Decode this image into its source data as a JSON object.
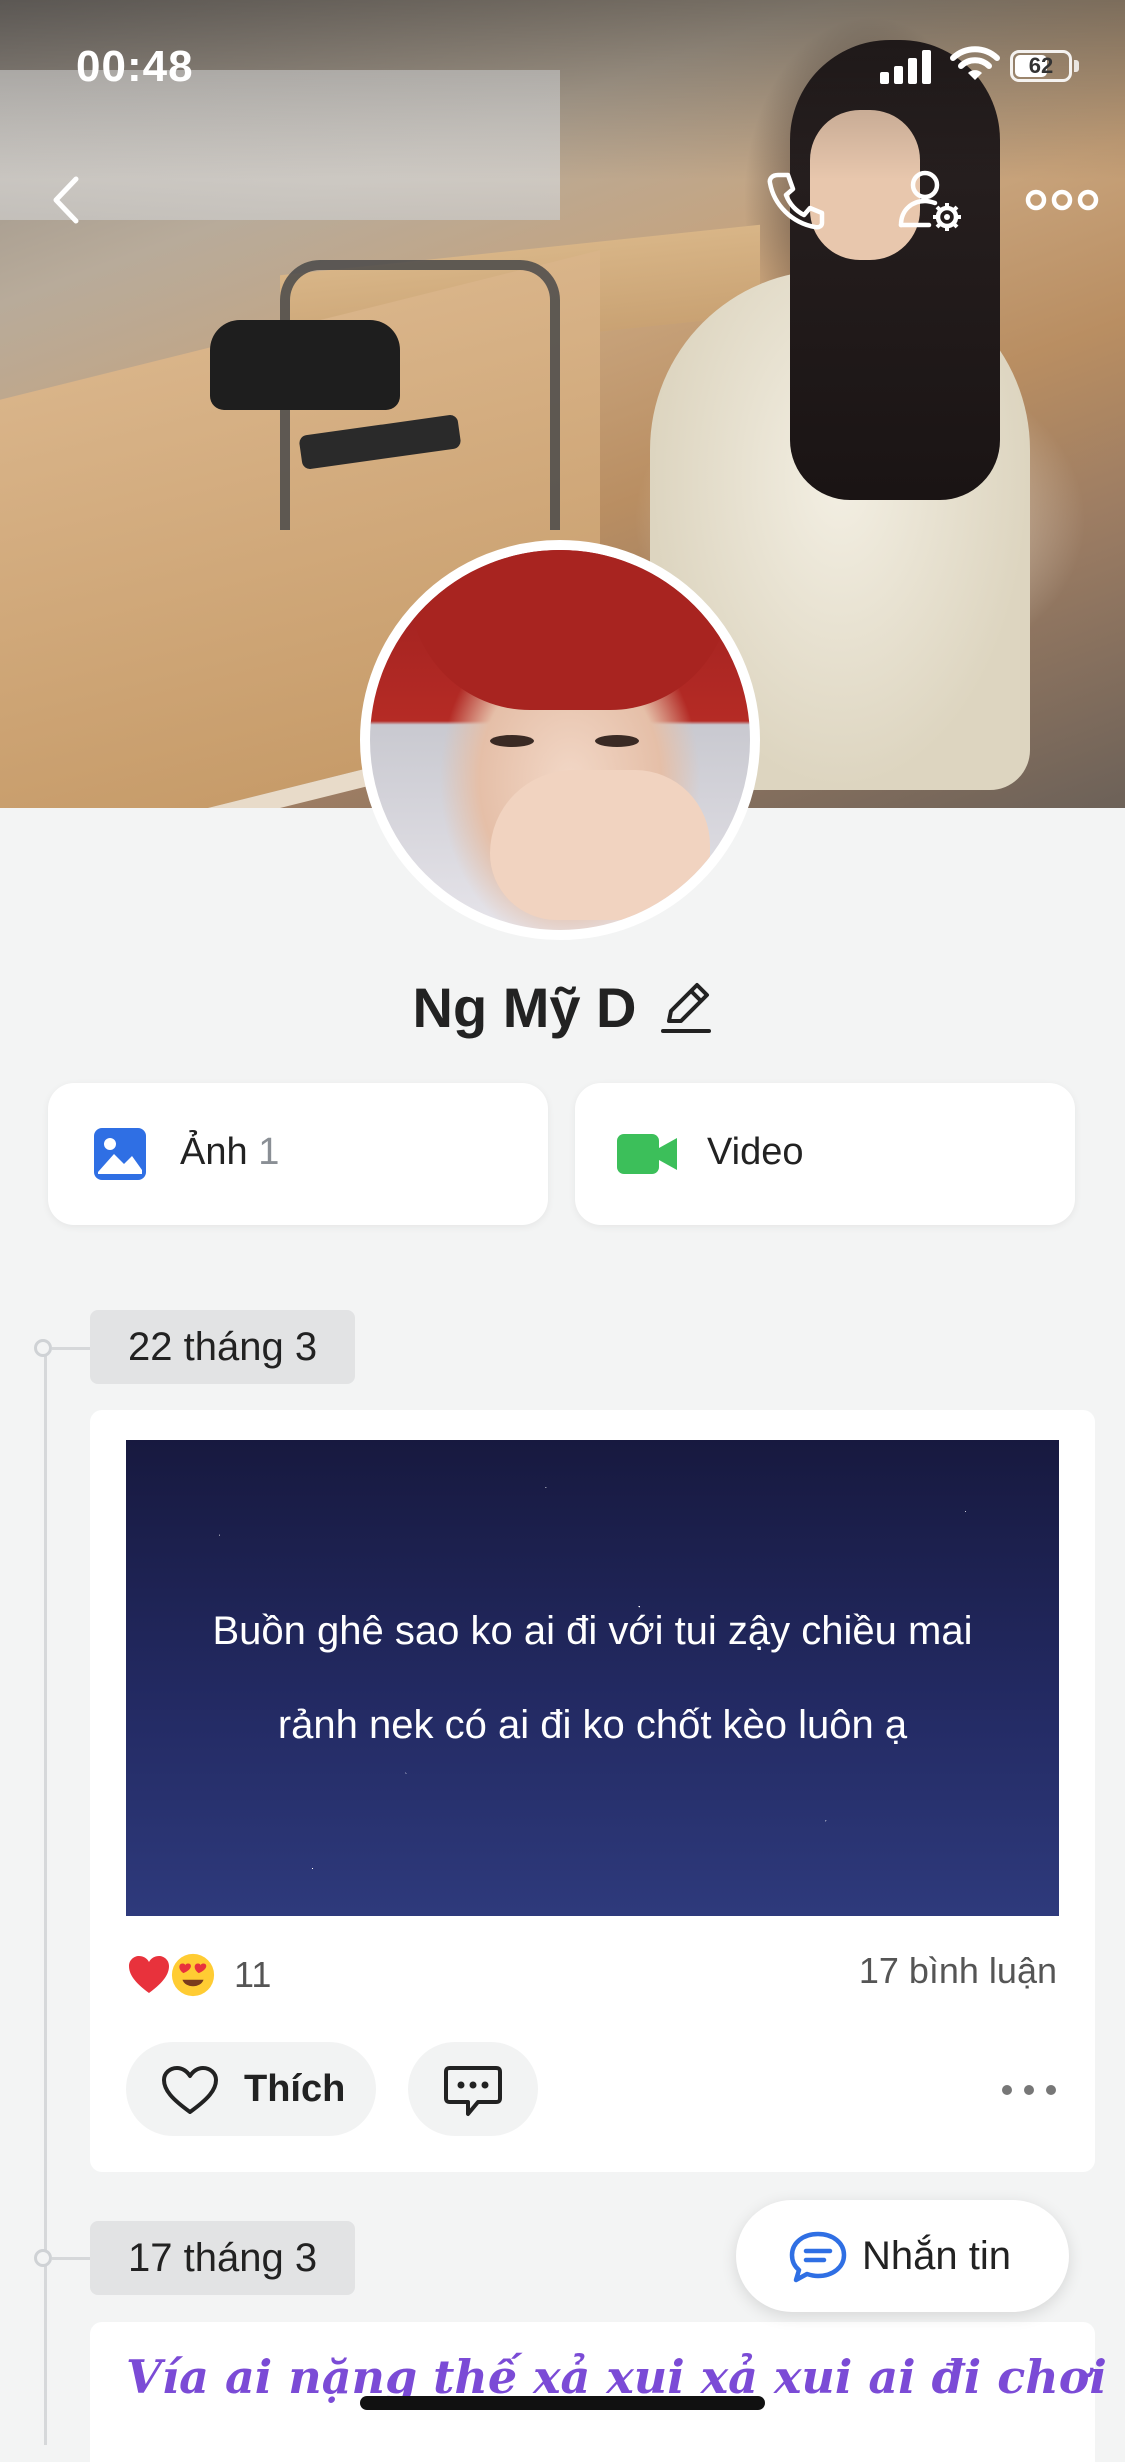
{
  "status_bar": {
    "time": "00:48",
    "battery": "62",
    "battery_level": 0.62
  },
  "header": {
    "back_icon": "chevron-left-icon",
    "call_icon": "phone-icon",
    "settings_icon": "user-settings-icon",
    "more_icon": "more-horizontal-icon"
  },
  "profile": {
    "name": "Ng Mỹ D",
    "edit_icon": "pencil-icon"
  },
  "media": {
    "photos_label": "Ảnh",
    "photos_count": "1",
    "photos_icon": "image-icon",
    "photos_color": "#2f6fe4",
    "video_label": "Video",
    "video_icon": "video-camera-icon",
    "video_color": "#3cbf5a"
  },
  "timeline": [
    {
      "date": "22 tháng 3",
      "post_text": "Buồn ghê sao ko ai đi với tui zậy chiều mai rảnh nek có ai đi ko chốt kèo luôn ạ",
      "reactions": [
        "heart",
        "heart-eyes"
      ],
      "reaction_count": "11",
      "comments": "17 bình luận",
      "like_label": "Thích"
    },
    {
      "date": "17 tháng 3",
      "post_text": "Vía ai nặng thế xả xui xả xui ai đi chơi"
    }
  ],
  "message_button": {
    "label": "Nhắn tin",
    "icon": "chat-bubble-icon",
    "color": "#2f6fe4"
  }
}
